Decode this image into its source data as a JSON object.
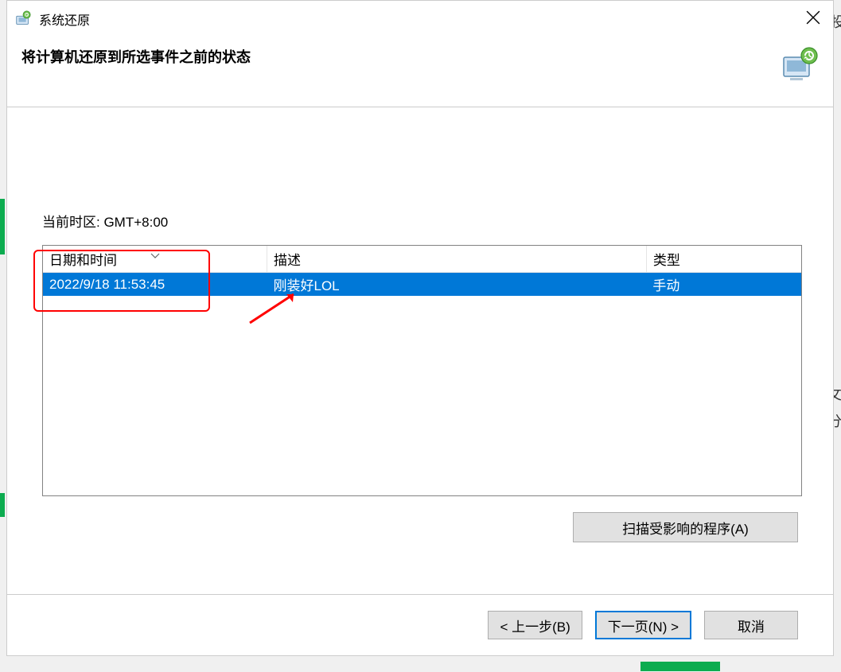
{
  "window": {
    "title": "系统还原"
  },
  "header": {
    "title": "将计算机还原到所选事件之前的状态"
  },
  "content": {
    "timezone_label": "当前时区: GMT+8:00"
  },
  "table": {
    "headers": {
      "date": "日期和时间",
      "description": "描述",
      "type": "类型"
    },
    "rows": [
      {
        "date": "2022/9/18 11:53:45",
        "description": "刚装好LOL",
        "type": "手动"
      }
    ]
  },
  "buttons": {
    "scan": "扫描受影响的程序(A)",
    "back": "< 上一步(B)",
    "next": "下一页(N) >",
    "cancel": "取消"
  }
}
